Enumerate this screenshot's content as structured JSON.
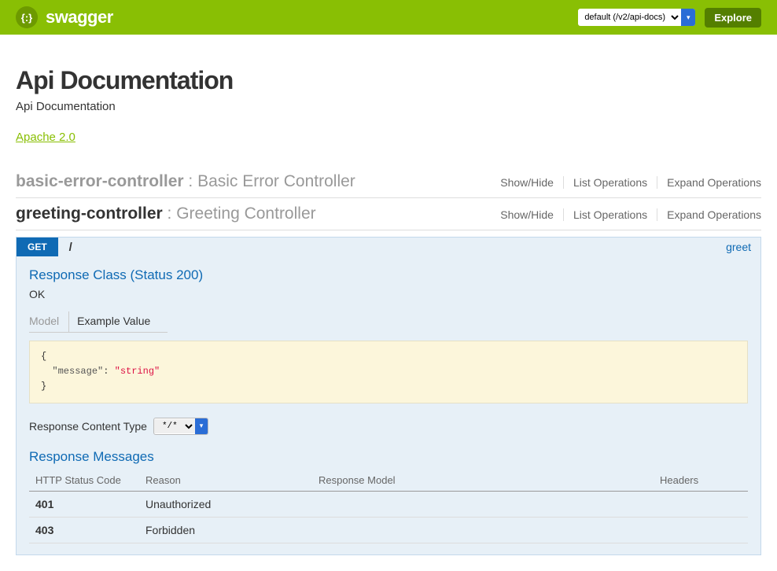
{
  "header": {
    "logo_glyph": "{:}",
    "logo_text": "swagger",
    "spec_selected": "default (/v2/api-docs)",
    "explore_label": "Explore"
  },
  "page": {
    "title": "Api Documentation",
    "subtitle": "Api Documentation",
    "license_label": "Apache 2.0"
  },
  "controllers": [
    {
      "name": "basic-error-controller",
      "desc": "Basic Error Controller",
      "active": false,
      "actions": {
        "show": "Show/Hide",
        "list": "List Operations",
        "expand": "Expand Operations"
      }
    },
    {
      "name": "greeting-controller",
      "desc": "Greeting Controller",
      "active": true,
      "actions": {
        "show": "Show/Hide",
        "list": "List Operations",
        "expand": "Expand Operations"
      }
    }
  ],
  "endpoint": {
    "method": "GET",
    "path": "/",
    "nickname": "greet",
    "response_class_title": "Response Class (Status 200)",
    "status_text": "OK",
    "tabs": {
      "model": "Model",
      "example": "Example Value"
    },
    "example_json": "{\n  \"message\": \"string\"\n}",
    "content_type_label": "Response Content Type",
    "content_type_value": "*/*",
    "response_messages_title": "Response Messages",
    "table_headers": {
      "code": "HTTP Status Code",
      "reason": "Reason",
      "model": "Response Model",
      "headers": "Headers"
    },
    "responses": [
      {
        "code": "401",
        "reason": "Unauthorized"
      },
      {
        "code": "403",
        "reason": "Forbidden"
      }
    ]
  }
}
